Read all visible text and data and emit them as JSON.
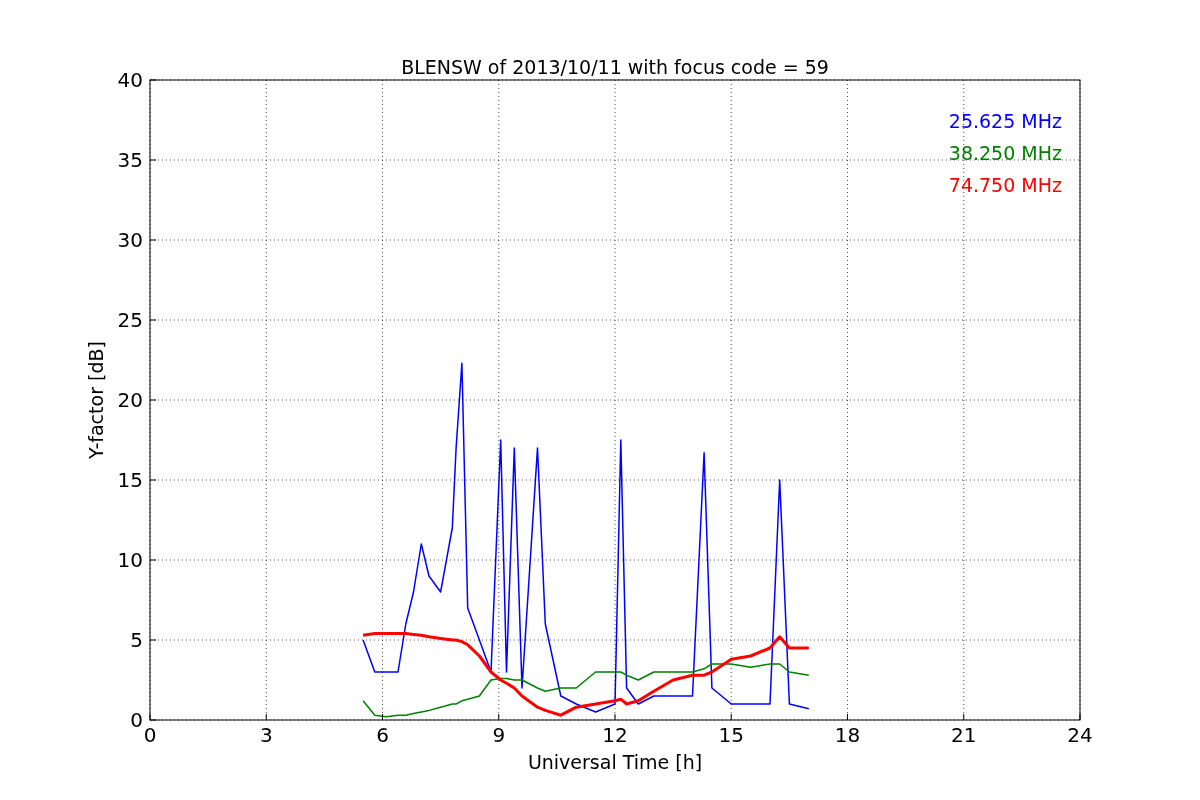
{
  "chart_data": {
    "type": "line",
    "title": "BLENSW of 2013/10/11 with focus code = 59",
    "xlabel": "Universal Time [h]",
    "ylabel": "Y-factor [dB]",
    "x": [
      5.5,
      5.8,
      6.1,
      6.4,
      6.6,
      6.8,
      7.0,
      7.2,
      7.5,
      7.8,
      7.9,
      8.05,
      8.2,
      8.5,
      8.8,
      9.05,
      9.2,
      9.4,
      9.6,
      10.0,
      10.2,
      10.6,
      11.0,
      11.5,
      12.0,
      12.15,
      12.3,
      12.6,
      13.0,
      13.5,
      14.0,
      14.3,
      14.5,
      15.0,
      15.5,
      16.0,
      16.25,
      16.5,
      17.0
    ],
    "series": [
      {
        "name": "25.625 MHz",
        "color": "#0000ff",
        "values": [
          5,
          3,
          3,
          3,
          6,
          8,
          11,
          9,
          8,
          12,
          17,
          22.3,
          7,
          5,
          3,
          17.5,
          3,
          17,
          2,
          17,
          6,
          1.5,
          1,
          0.5,
          1,
          17.5,
          2,
          1,
          1.5,
          1.5,
          1.5,
          16.7,
          2,
          1,
          1,
          1,
          15,
          1,
          0.7
        ]
      },
      {
        "name": "38.250 MHz",
        "color": "#008000",
        "values": [
          1.2,
          0.3,
          0.2,
          0.3,
          0.3,
          0.4,
          0.5,
          0.6,
          0.8,
          1,
          1,
          1.2,
          1.3,
          1.5,
          2.5,
          2.6,
          2.6,
          2.5,
          2.5,
          2,
          1.8,
          2,
          2,
          3,
          3,
          3,
          2.8,
          2.5,
          3,
          3,
          3,
          3.2,
          3.5,
          3.5,
          3.3,
          3.5,
          3.5,
          3,
          2.8
        ]
      },
      {
        "name": "74.750 MHz",
        "color": "#ff0000",
        "values": [
          5.3,
          5.4,
          5.4,
          5.4,
          5.4,
          5.35,
          5.3,
          5.2,
          5.1,
          5,
          5,
          4.9,
          4.7,
          4,
          3,
          2.5,
          2.3,
          2,
          1.5,
          0.8,
          0.6,
          0.3,
          0.8,
          1,
          1.2,
          1.3,
          1,
          1.2,
          1.8,
          2.5,
          2.8,
          2.8,
          3,
          3.8,
          4,
          4.5,
          5.2,
          4.5,
          4.5
        ]
      }
    ],
    "xlim": [
      0,
      24
    ],
    "ylim": [
      0,
      40
    ],
    "xticks": [
      0,
      3,
      6,
      9,
      12,
      15,
      18,
      21,
      24
    ],
    "yticks": [
      0,
      5,
      10,
      15,
      20,
      25,
      30,
      35,
      40
    ],
    "grid": true
  }
}
